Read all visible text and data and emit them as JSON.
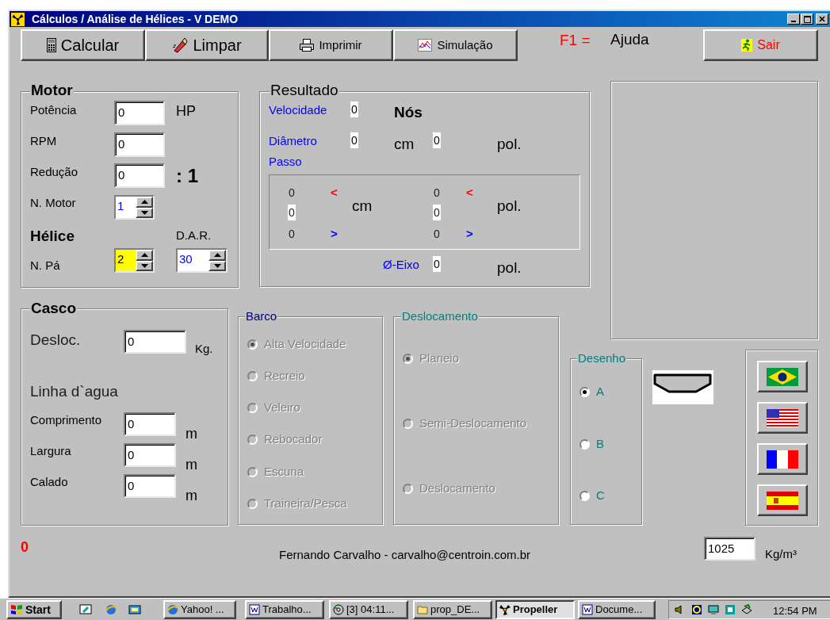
{
  "window": {
    "title": "Cálculos / Análise de Hélices - V DEMO"
  },
  "toolbar": [
    {
      "label": "Calcular"
    },
    {
      "label": "Limpar"
    },
    {
      "label": "Imprimir"
    },
    {
      "label": "Simulação"
    }
  ],
  "help": {
    "key": "F1 =",
    "label": "Ajuda"
  },
  "exit_button": {
    "label": "Sair"
  },
  "motor": {
    "title": "Motor",
    "potencia": {
      "label": "Potência",
      "value": "0",
      "unit": "HP"
    },
    "rpm": {
      "label": "RPM",
      "value": "0"
    },
    "reducao": {
      "label": "Redução",
      "value": "0",
      "unit": ": 1"
    },
    "n_motor": {
      "label": "N. Motor",
      "value": "1"
    }
  },
  "helice": {
    "title": "Hélice",
    "n_pa": {
      "label": "N. Pá",
      "value": "2",
      "highlighted": true
    },
    "dar": {
      "label": "D.A.R.",
      "value": "30"
    }
  },
  "resultado": {
    "title": "Resultado",
    "velocidade": {
      "label": "Velocidade",
      "value": "0",
      "unit": "Nós"
    },
    "diametro": {
      "label": "Diâmetro",
      "value_cm": "0",
      "unit_cm": "cm",
      "value_pol": "0",
      "unit_pol": "pol."
    },
    "passo": {
      "label": "Passo",
      "cm_unit": "cm",
      "pol_unit": "pol.",
      "rows": [
        {
          "kind": "low",
          "cm": "0",
          "marker_cm": "<",
          "pol": "0",
          "marker_pol": "<"
        },
        {
          "kind": "mid",
          "cm": "0",
          "pol": "0"
        },
        {
          "kind": "high",
          "cm": "0",
          "marker_cm": ">",
          "pol": "0",
          "marker_pol": ">"
        }
      ]
    },
    "eixo": {
      "label": "Ø-Eixo",
      "value": "0",
      "unit": "pol."
    }
  },
  "casco": {
    "title": "Casco",
    "desloc": {
      "label": "Desloc.",
      "value": "0",
      "unit": "Kg."
    },
    "linha_dagua": "Linha d`agua",
    "fields": [
      {
        "label": "Comprimento",
        "value": "0",
        "unit": "m"
      },
      {
        "label": "Largura",
        "value": "0",
        "unit": "m"
      },
      {
        "label": "Calado",
        "value": "0",
        "unit": "m"
      }
    ]
  },
  "barco": {
    "title": "Barco",
    "disabled": true,
    "options": [
      {
        "label": "Alta Velocidade",
        "selected": true
      },
      {
        "label": "Recreio",
        "selected": false
      },
      {
        "label": "Veleiro",
        "selected": false
      },
      {
        "label": "Rebocador",
        "selected": false
      },
      {
        "label": "Escuna",
        "selected": false
      },
      {
        "label": "Traineira/Pesca",
        "selected": false
      }
    ]
  },
  "deslocamento": {
    "title": "Deslocamento",
    "disabled": true,
    "options": [
      {
        "label": "Planeio",
        "selected": true
      },
      {
        "label": "Semi-Deslocamento",
        "selected": false
      },
      {
        "label": "Deslocamento",
        "selected": false
      }
    ]
  },
  "desenho": {
    "title": "Desenho",
    "disabled": false,
    "options": [
      {
        "label": "A",
        "selected": true
      },
      {
        "label": "B",
        "selected": false
      },
      {
        "label": "C",
        "selected": false
      }
    ]
  },
  "footer": {
    "counter": "0",
    "credit": "Fernando Carvalho - carvalho@centroin.com.br",
    "density": "1025",
    "density_unit": "Kg/m³"
  },
  "taskbar": {
    "start": "Start",
    "tasks": [
      {
        "label": "Yahoo! ...",
        "selected": false
      },
      {
        "label": "Trabalho...",
        "selected": false
      },
      {
        "label": "[3] 04:11...",
        "selected": false
      },
      {
        "label": "prop_DE...",
        "selected": false
      },
      {
        "label": "Propeller",
        "selected": true
      },
      {
        "label": "Docume...",
        "selected": false
      }
    ],
    "clock": "12:54 PM"
  }
}
